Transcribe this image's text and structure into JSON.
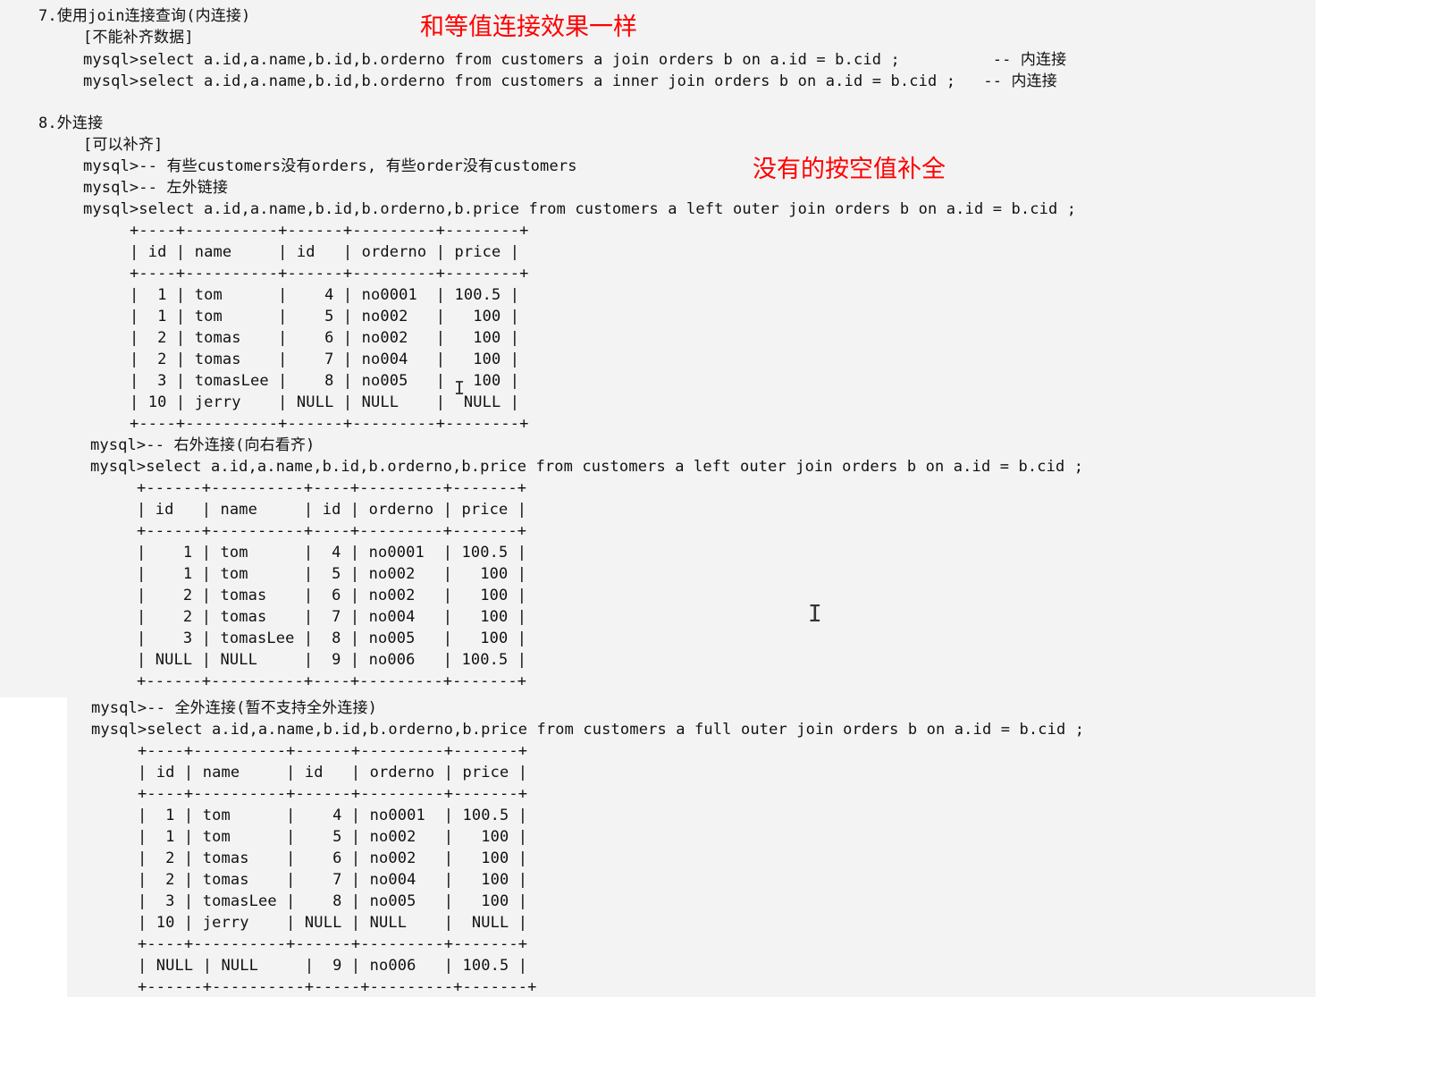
{
  "annotations": {
    "equijoin_note": "和等值连接效果一样",
    "fill_null_note": "没有的按空值补全",
    "color": "#ff0000"
  },
  "section7": {
    "heading": "7.使用join连接查询(内连接)",
    "note": "[不能补齐数据]",
    "queries": [
      "mysql>select a.id,a.name,b.id,b.orderno from customers a join orders b on a.id = b.cid ;          -- 内连接",
      "mysql>select a.id,a.name,b.id,b.orderno from customers a inner join orders b on a.id = b.cid ;   -- 内连接"
    ]
  },
  "section8": {
    "heading": "8.外连接",
    "note": "[可以补齐]",
    "comments": [
      "mysql>-- 有些customers没有orders, 有些order没有customers",
      "mysql>-- 左外链接"
    ],
    "left_join": {
      "query": "mysql>select a.id,a.name,b.id,b.orderno,b.price from customers a left outer join orders b on a.id = b.cid ;",
      "table_lines": [
        "+----+----------+------+---------+--------+",
        "| id | name     | id   | orderno | price |",
        "+----+----------+------+---------+--------+",
        "|  1 | tom      |    4 | no0001  | 100.5 |",
        "|  1 | tom      |    5 | no002   |   100 |",
        "|  2 | tomas    |    6 | no002   |   100 |",
        "|  2 | tomas    |    7 | no004   |   100 |",
        "|  3 | tomasLee |    8 | no005   |   100 |",
        "| 10 | jerry    | NULL | NULL    |  NULL |",
        "+----+----------+------+---------+--------+"
      ]
    },
    "right_join": {
      "comment": "mysql>-- 右外连接(向右看齐)",
      "query": "mysql>select a.id,a.name,b.id,b.orderno,b.price from customers a left outer join orders b on a.id = b.cid ;",
      "table_lines": [
        "+------+----------+----+---------+-------+",
        "| id   | name     | id | orderno | price |",
        "+------+----------+----+---------+-------+",
        "|    1 | tom      |  4 | no0001  | 100.5 |",
        "|    1 | tom      |  5 | no002   |   100 |",
        "|    2 | tomas    |  6 | no002   |   100 |",
        "|    2 | tomas    |  7 | no004   |   100 |",
        "|    3 | tomasLee |  8 | no005   |   100 |",
        "| NULL | NULL     |  9 | no006   | 100.5 |",
        "+------+----------+----+---------+-------+"
      ]
    },
    "full_join": {
      "comment": "mysql>-- 全外连接(暂不支持全外连接)",
      "query": "mysql>select a.id,a.name,b.id,b.orderno,b.price from customers a full outer join orders b on a.id = b.cid ;",
      "table_lines": [
        "+----+----------+------+---------+-------+",
        "| id | name     | id   | orderno | price |",
        "+----+----------+------+---------+-------+",
        "|  1 | tom      |    4 | no0001  | 100.5 |",
        "|  1 | tom      |    5 | no002   |   100 |",
        "|  2 | tomas    |    6 | no002   |   100 |",
        "|  2 | tomas    |    7 | no004   |   100 |",
        "|  3 | tomasLee |    8 | no005   |   100 |",
        "| 10 | jerry    | NULL | NULL    |  NULL |",
        "+----+----------+------+---------+-------+",
        "| NULL | NULL     |  9 | no006   | 100.5 |",
        "+------+----------+-----+---------+-------+"
      ]
    }
  }
}
